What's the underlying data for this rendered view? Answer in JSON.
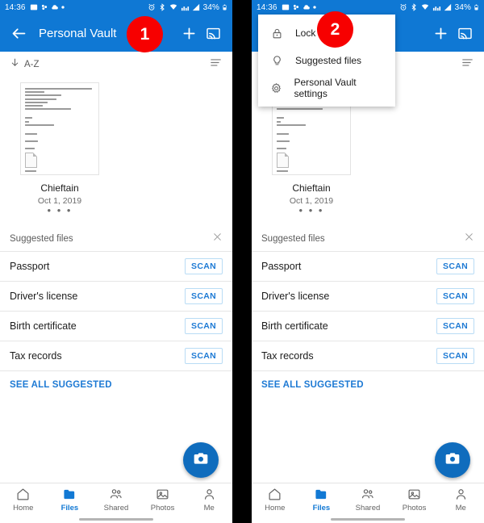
{
  "status_bar": {
    "time": "14:36",
    "left_icons": [
      "screenshot-icon",
      "onedrive-icon",
      "cloud-icon",
      "dot-icon"
    ],
    "right_icons": [
      "alarm-icon",
      "bluetooth-icon",
      "wifi-icon",
      "network-icon",
      "signal-icon"
    ],
    "battery_text": "34%",
    "battery_icon": "battery-icon"
  },
  "app_bar": {
    "back_icon": "back-arrow-icon",
    "title": "Personal Vault",
    "add_icon": "plus-icon",
    "cast_icon": "cast-icon"
  },
  "sort_bar": {
    "arrow_icon": "sort-down-arrow-icon",
    "label": "A-Z",
    "view_icon": "list-view-icon"
  },
  "file": {
    "name": "Chieftain",
    "date": "Oct 1, 2019",
    "overflow": "• • •",
    "thumbnail_icon": "document-thumbnail"
  },
  "suggested": {
    "heading": "Suggested files",
    "close_icon": "close-icon",
    "rows": [
      {
        "label": "Passport",
        "action": "SCAN"
      },
      {
        "label": "Driver's license",
        "action": "SCAN"
      },
      {
        "label": "Birth certificate",
        "action": "SCAN"
      },
      {
        "label": "Tax records",
        "action": "SCAN"
      }
    ],
    "see_all": "SEE ALL SUGGESTED"
  },
  "fab": {
    "icon": "camera-icon"
  },
  "bottom_nav": {
    "items": [
      {
        "label": "Home",
        "icon": "home-icon",
        "active": false
      },
      {
        "label": "Files",
        "icon": "folder-icon",
        "active": true
      },
      {
        "label": "Shared",
        "icon": "shared-icon",
        "active": false
      },
      {
        "label": "Photos",
        "icon": "photos-icon",
        "active": false
      },
      {
        "label": "Me",
        "icon": "person-icon",
        "active": false
      }
    ]
  },
  "overflow_menu": {
    "items": [
      {
        "label": "Lock",
        "icon": "lock-icon"
      },
      {
        "label": "Suggested files",
        "icon": "lightbulb-icon"
      },
      {
        "label": "Personal Vault settings",
        "icon": "gear-icon"
      }
    ]
  },
  "badges": [
    {
      "text": "1"
    },
    {
      "text": "2"
    }
  ],
  "colors": {
    "header_blue": "#0f78d4",
    "accent_blue": "#1e7ad4",
    "badge_red": "#f70000",
    "fab_blue": "#0f6cbd"
  }
}
